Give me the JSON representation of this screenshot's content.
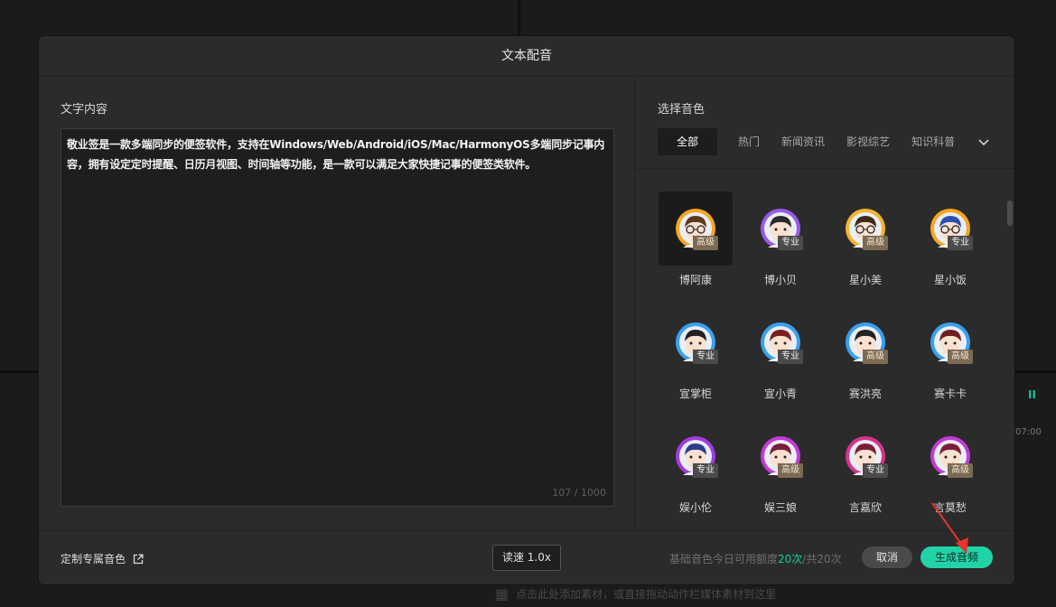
{
  "background": {
    "hint_text": "点击此处添加素材，或直接拖动动作栏媒体素材到这里",
    "right_label_a": "II",
    "right_label_b": "07:00"
  },
  "modal": {
    "title": "文本配音",
    "text_section": {
      "label": "文字内容",
      "content": "敬业签是一款多端同步的便签软件，支持在Windows/Web/Android/iOS/Mac/HarmonyOS多端同步记事内容，拥有设定定时提醒、日历月视图、时间轴等功能，是一款可以满足大家快捷记事的便签类软件。",
      "counter": "107 / 1000"
    },
    "voice_section": {
      "label": "选择音色",
      "tabs": [
        {
          "label": "全部",
          "active": true
        },
        {
          "label": "热门",
          "active": false
        },
        {
          "label": "新闻资讯",
          "active": false
        },
        {
          "label": "影视综艺",
          "active": false
        },
        {
          "label": "知识科普",
          "active": false
        }
      ],
      "voices": [
        {
          "name": "博阿康",
          "badge": "高级",
          "tier": "senior",
          "selected": true,
          "ring": "#f5a623",
          "hair": "#5a3a22",
          "glasses": true
        },
        {
          "name": "博小贝",
          "badge": "专业",
          "tier": "pro",
          "selected": false,
          "ring": "#9b59e8",
          "hair": "#2a2a2a",
          "glasses": false
        },
        {
          "name": "星小美",
          "badge": "高级",
          "tier": "senior",
          "selected": false,
          "ring": "#f5b431",
          "hair": "#3d2a1a",
          "glasses": true
        },
        {
          "name": "星小饭",
          "badge": "专业",
          "tier": "pro",
          "selected": false,
          "ring": "#f5a623",
          "hair": "#2d4fb0",
          "glasses": true
        },
        {
          "name": "宣掌柜",
          "badge": "专业",
          "tier": "pro",
          "selected": false,
          "ring": "#3aa0f0",
          "hair": "#222222",
          "glasses": false
        },
        {
          "name": "宣小青",
          "badge": "专业",
          "tier": "pro",
          "selected": false,
          "ring": "#3aa0f0",
          "hair": "#7a1f1f",
          "glasses": false
        },
        {
          "name": "赛洪亮",
          "badge": "高级",
          "tier": "senior",
          "selected": false,
          "ring": "#3aa0f0",
          "hair": "#222222",
          "glasses": false
        },
        {
          "name": "赛卡卡",
          "badge": "高级",
          "tier": "senior",
          "selected": false,
          "ring": "#3aa0f0",
          "hair": "#6e1e1e",
          "glasses": false
        },
        {
          "name": "娱小伦",
          "badge": "专业",
          "tier": "pro",
          "selected": false,
          "ring": "#a23be0",
          "hair": "#2b3d8a",
          "glasses": false
        },
        {
          "name": "娱三娘",
          "badge": "高级",
          "tier": "senior",
          "selected": false,
          "ring": "#c23bd6",
          "hair": "#7a1f3a",
          "glasses": false
        },
        {
          "name": "言嘉欣",
          "badge": "专业",
          "tier": "pro",
          "selected": false,
          "ring": "#d6348f",
          "hair": "#7a1f3a",
          "glasses": false
        },
        {
          "name": "言莫愁",
          "badge": "高级",
          "tier": "senior",
          "selected": false,
          "ring": "#c23bd6",
          "hair": "#7a1f3a",
          "glasses": false
        }
      ]
    },
    "footer": {
      "custom_voice_label": "定制专属音色",
      "speed_label": "读速 1.0x",
      "quota_prefix": "基础音色今日可用额度",
      "quota_used": "20次",
      "quota_suffix": "/共20次",
      "cancel_label": "取消",
      "generate_label": "生成音频"
    }
  },
  "colors": {
    "accent": "#21d4a8",
    "annotation_arrow": "#e8322c"
  }
}
